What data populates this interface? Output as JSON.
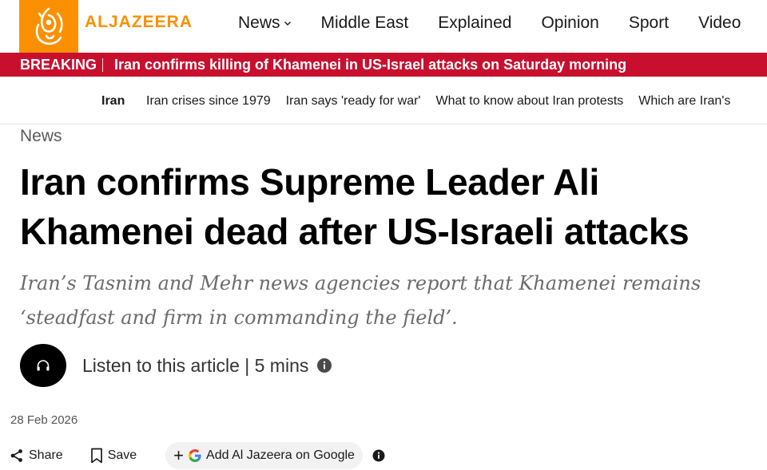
{
  "header": {
    "logo_text": "ALJAZEERA",
    "nav": [
      {
        "label": "News",
        "has_dropdown": true
      },
      {
        "label": "Middle East"
      },
      {
        "label": "Explained"
      },
      {
        "label": "Opinion"
      },
      {
        "label": "Sport"
      },
      {
        "label": "Video"
      }
    ],
    "brand_color": "#fa9000"
  },
  "breaking": {
    "label": "BREAKING",
    "headline": "Iran confirms killing of Khamenei in US-Israel attacks on Saturday morning",
    "color": "#c8102e"
  },
  "topics": {
    "label": "Iran",
    "links": [
      "Iran crises since 1979",
      "Iran says 'ready for war'",
      "What to know about Iran protests",
      "Which are Iran's"
    ]
  },
  "article": {
    "category": "News",
    "title": "Iran confirms Supreme Leader Ali Khamenei dead after US-Israeli attacks",
    "subtitle": "Iran’s Tasnim and Mehr news agencies report that Khamenei remains ‘steadfast and firm in commanding the field’.",
    "listen_text": "Listen to this article | 5 mins",
    "date": "28 Feb 2026"
  },
  "actions": {
    "share": "Share",
    "save": "Save",
    "google": "Add Al Jazeera on Google"
  },
  "icons": {
    "listen": "headphones-icon",
    "info": "info-icon",
    "share": "share-icon",
    "save": "bookmark-icon",
    "google": "google-g-icon"
  }
}
